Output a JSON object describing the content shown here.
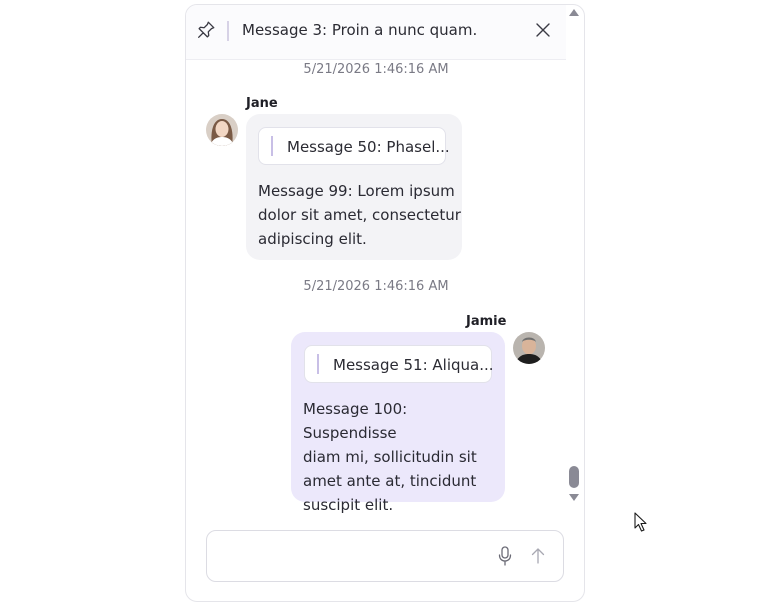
{
  "pinned": {
    "text": "Message 3: Proin a nunc quam."
  },
  "messages": [
    {
      "timestamp": "5/21/2026 1:46:16 AM",
      "sender": "Jane",
      "quote": "Message 50: Phasel...",
      "lines": [
        "Message 99: Lorem ipsum",
        "dolor sit amet, consectetur",
        "adipiscing elit."
      ]
    },
    {
      "timestamp": "5/21/2026 1:46:16 AM",
      "sender": "Jamie",
      "quote": "Message 51: Aliqua...",
      "lines": [
        "Message 100: Suspendisse",
        "diam mi, sollicitudin sit",
        "amet ante at, tincidunt",
        "suscipit elit."
      ]
    }
  ],
  "colors": {
    "incoming_bubble": "#f3f3f6",
    "outgoing_bubble": "#ece8fb",
    "quote_accent": "#c8bfe6"
  },
  "icons": {
    "pin": "pin-icon",
    "close": "close-icon",
    "mic": "microphone-icon",
    "send": "send-arrow-icon"
  }
}
